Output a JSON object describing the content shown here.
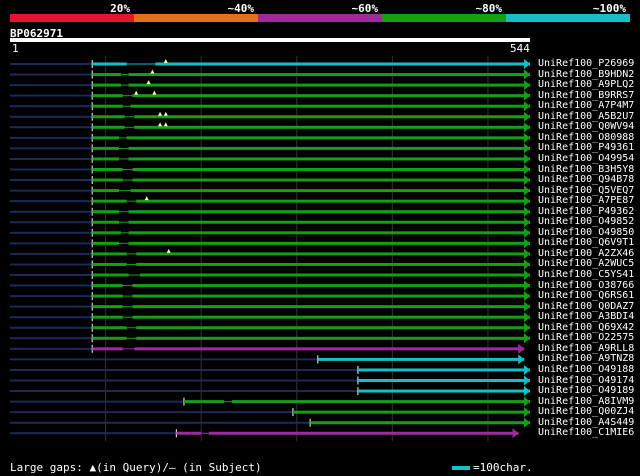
{
  "legend": {
    "labels": [
      "20%",
      "~40%",
      "~60%",
      "~80%",
      "~100%"
    ],
    "colors": [
      "#e8142d",
      "#e2701c",
      "#9c2c9c",
      "#14a014",
      "#13c0c8"
    ]
  },
  "query": {
    "name": "BP062971",
    "start": "1",
    "end": "544",
    "length": 544
  },
  "hits": [
    {
      "name": "UniRef100_P26969",
      "color": "#13c0c8",
      "start": 86,
      "end": 544,
      "gaps": [
        [
          102,
          122
        ],
        [
          152,
          544
        ]
      ],
      "qgaps": [
        163
      ]
    },
    {
      "name": "UniRef100_B9HDN2",
      "color": "#14a014",
      "start": 86,
      "end": 544,
      "gaps": [
        [
          102,
          116
        ],
        [
          124,
          544
        ]
      ],
      "qgaps": [
        149
      ]
    },
    {
      "name": "UniRef100_A9PLQ2",
      "color": "#14a014",
      "start": 86,
      "end": 544,
      "gaps": [
        [
          102,
          116
        ],
        [
          124,
          544
        ]
      ],
      "qgaps": [
        145
      ]
    },
    {
      "name": "UniRef100_B9RRS7",
      "color": "#14a014",
      "start": 86,
      "end": 544,
      "gaps": [
        [
          100,
          118
        ],
        [
          128,
          544
        ]
      ],
      "qgaps": [
        132,
        151
      ]
    },
    {
      "name": "UniRef100_A7P4M7",
      "color": "#14a014",
      "start": 86,
      "end": 544,
      "gaps": [
        [
          102,
          118
        ],
        [
          126,
          544
        ]
      ],
      "qgaps": []
    },
    {
      "name": "UniRef100_A5B2U7",
      "color": "#14a014",
      "start": 86,
      "end": 544,
      "gaps": [
        [
          102,
          120
        ],
        [
          130,
          544
        ]
      ],
      "qgaps": [
        157,
        163
      ]
    },
    {
      "name": "UniRef100_Q0WV94",
      "color": "#14a014",
      "start": 86,
      "end": 544,
      "gaps": [
        [
          102,
          120
        ],
        [
          130,
          544
        ]
      ],
      "qgaps": [
        157,
        163
      ]
    },
    {
      "name": "UniRef100_O80988",
      "color": "#14a014",
      "start": 86,
      "end": 544,
      "gaps": [
        [
          100,
          114
        ],
        [
          122,
          544
        ]
      ],
      "qgaps": []
    },
    {
      "name": "UniRef100_P49361",
      "color": "#14a014",
      "start": 86,
      "end": 544,
      "gaps": [
        [
          100,
          114
        ],
        [
          124,
          544
        ]
      ],
      "qgaps": []
    },
    {
      "name": "UniRef100_O49954",
      "color": "#14a014",
      "start": 86,
      "end": 544,
      "gaps": [
        [
          98,
          114
        ],
        [
          124,
          544
        ]
      ],
      "qgaps": []
    },
    {
      "name": "UniRef100_B3H5Y8",
      "color": "#14a014",
      "start": 86,
      "end": 544,
      "gaps": [
        [
          100,
          118
        ],
        [
          128,
          544
        ]
      ],
      "qgaps": []
    },
    {
      "name": "UniRef100_Q94B78",
      "color": "#14a014",
      "start": 86,
      "end": 544,
      "gaps": [
        [
          100,
          118
        ],
        [
          128,
          544
        ]
      ],
      "qgaps": []
    },
    {
      "name": "UniRef100_Q5VEQ7",
      "color": "#14a014",
      "start": 86,
      "end": 544,
      "gaps": [
        [
          100,
          114
        ],
        [
          126,
          544
        ]
      ],
      "qgaps": []
    },
    {
      "name": "UniRef100_A7PE87",
      "color": "#14a014",
      "start": 86,
      "end": 544,
      "gaps": [
        [
          102,
          122
        ],
        [
          132,
          544
        ]
      ],
      "qgaps": [
        143
      ]
    },
    {
      "name": "UniRef100_P49362",
      "color": "#14a014",
      "start": 86,
      "end": 544,
      "gaps": [
        [
          100,
          114
        ],
        [
          124,
          544
        ]
      ],
      "qgaps": []
    },
    {
      "name": "UniRef100_O49852",
      "color": "#14a014",
      "start": 86,
      "end": 544,
      "gaps": [
        [
          100,
          114
        ],
        [
          124,
          544
        ]
      ],
      "qgaps": []
    },
    {
      "name": "UniRef100_O49850",
      "color": "#14a014",
      "start": 86,
      "end": 544,
      "gaps": [
        [
          100,
          116
        ],
        [
          124,
          544
        ]
      ],
      "qgaps": []
    },
    {
      "name": "UniRef100_Q6V9T1",
      "color": "#14a014",
      "start": 86,
      "end": 544,
      "gaps": [
        [
          100,
          114
        ],
        [
          124,
          544
        ]
      ],
      "qgaps": []
    },
    {
      "name": "UniRef100_A2ZX46",
      "color": "#14a014",
      "start": 86,
      "end": 544,
      "gaps": [
        [
          104,
          122
        ],
        [
          132,
          544
        ]
      ],
      "qgaps": [
        166
      ]
    },
    {
      "name": "UniRef100_A2WUC5",
      "color": "#14a014",
      "start": 86,
      "end": 544,
      "gaps": [
        [
          104,
          122
        ],
        [
          132,
          544
        ]
      ],
      "qgaps": []
    },
    {
      "name": "UniRef100_C5YS41",
      "color": "#14a014",
      "start": 86,
      "end": 544,
      "gaps": [
        [
          104,
          124
        ],
        [
          136,
          544
        ]
      ],
      "qgaps": []
    },
    {
      "name": "UniRef100_O38766",
      "color": "#14a014",
      "start": 86,
      "end": 544,
      "gaps": [
        [
          104,
          118
        ],
        [
          128,
          544
        ]
      ],
      "qgaps": []
    },
    {
      "name": "UniRef100_Q6RS61",
      "color": "#14a014",
      "start": 86,
      "end": 544,
      "gaps": [
        [
          104,
          118
        ],
        [
          128,
          544
        ]
      ],
      "qgaps": []
    },
    {
      "name": "UniRef100_Q0DAZ7",
      "color": "#14a014",
      "start": 86,
      "end": 544,
      "gaps": [
        [
          104,
          118
        ],
        [
          128,
          544
        ]
      ],
      "qgaps": []
    },
    {
      "name": "UniRef100_A3BDI4",
      "color": "#14a014",
      "start": 86,
      "end": 544,
      "gaps": [
        [
          104,
          118
        ],
        [
          128,
          544
        ]
      ],
      "qgaps": []
    },
    {
      "name": "UniRef100_Q69X42",
      "color": "#14a014",
      "start": 86,
      "end": 544,
      "gaps": [
        [
          104,
          122
        ],
        [
          132,
          544
        ]
      ],
      "qgaps": []
    },
    {
      "name": "UniRef100_O22575",
      "color": "#14a014",
      "start": 86,
      "end": 544,
      "gaps": [
        [
          104,
          122
        ],
        [
          132,
          544
        ]
      ],
      "qgaps": []
    },
    {
      "name": "UniRef100_A9RLL8",
      "color": "#9c2c9c",
      "start": 86,
      "end": 538,
      "gaps": [
        [
          100,
          118
        ],
        [
          130,
          538
        ]
      ],
      "qgaps": []
    },
    {
      "name": "UniRef100_A9TNZ8",
      "color": "#13c0c8",
      "start": 322,
      "end": 538,
      "gaps": [],
      "qgaps": []
    },
    {
      "name": "UniRef100_O49188",
      "color": "#13c0c8",
      "start": 364,
      "end": 544,
      "gaps": [],
      "qgaps": []
    },
    {
      "name": "UniRef100_O49174",
      "color": "#13c0c8",
      "start": 364,
      "end": 544,
      "gaps": [],
      "qgaps": []
    },
    {
      "name": "UniRef100_O49189",
      "color": "#13c0c8",
      "start": 364,
      "end": 544,
      "gaps": [],
      "qgaps": []
    },
    {
      "name": "UniRef100_A8IVM9",
      "color": "#14a014",
      "start": 182,
      "end": 544,
      "gaps": [
        [
          200,
          224
        ],
        [
          232,
          544
        ]
      ],
      "qgaps": []
    },
    {
      "name": "UniRef100_Q00ZJ4",
      "color": "#14a014",
      "start": 296,
      "end": 544,
      "gaps": [],
      "qgaps": []
    },
    {
      "name": "UniRef100_A4S449",
      "color": "#14a014",
      "start": 314,
      "end": 544,
      "gaps": [],
      "qgaps": []
    },
    {
      "name": "UniRef100_C1MIE6",
      "color": "#9c2c9c",
      "start": 174,
      "end": 532,
      "gaps": [
        [
          190,
          200
        ],
        [
          208,
          532
        ]
      ],
      "qgaps": []
    }
  ],
  "footer": {
    "large_gaps": "Large gaps: ▲(in Query)/— (in Subject)",
    "scale": "=100char."
  }
}
